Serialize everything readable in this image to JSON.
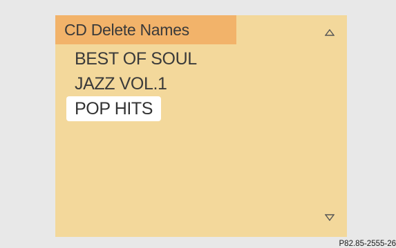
{
  "screen": {
    "title": "CD Delete Names",
    "scroll_up_icon": "triangle-up-outline",
    "scroll_down_icon": "triangle-down-outline",
    "items": [
      {
        "label": "BEST OF SOUL",
        "selected": false
      },
      {
        "label": "JAZZ VOL.1",
        "selected": false
      },
      {
        "label": "POP HITS",
        "selected": true
      }
    ]
  },
  "figure_ref": "P82.85-2555-26",
  "colors": {
    "background": "#e8e8e8",
    "screen_background": "#f3d89b",
    "header_highlight": "#f2b36a",
    "selection": "#ffffff",
    "text": "#3a3a3a"
  }
}
